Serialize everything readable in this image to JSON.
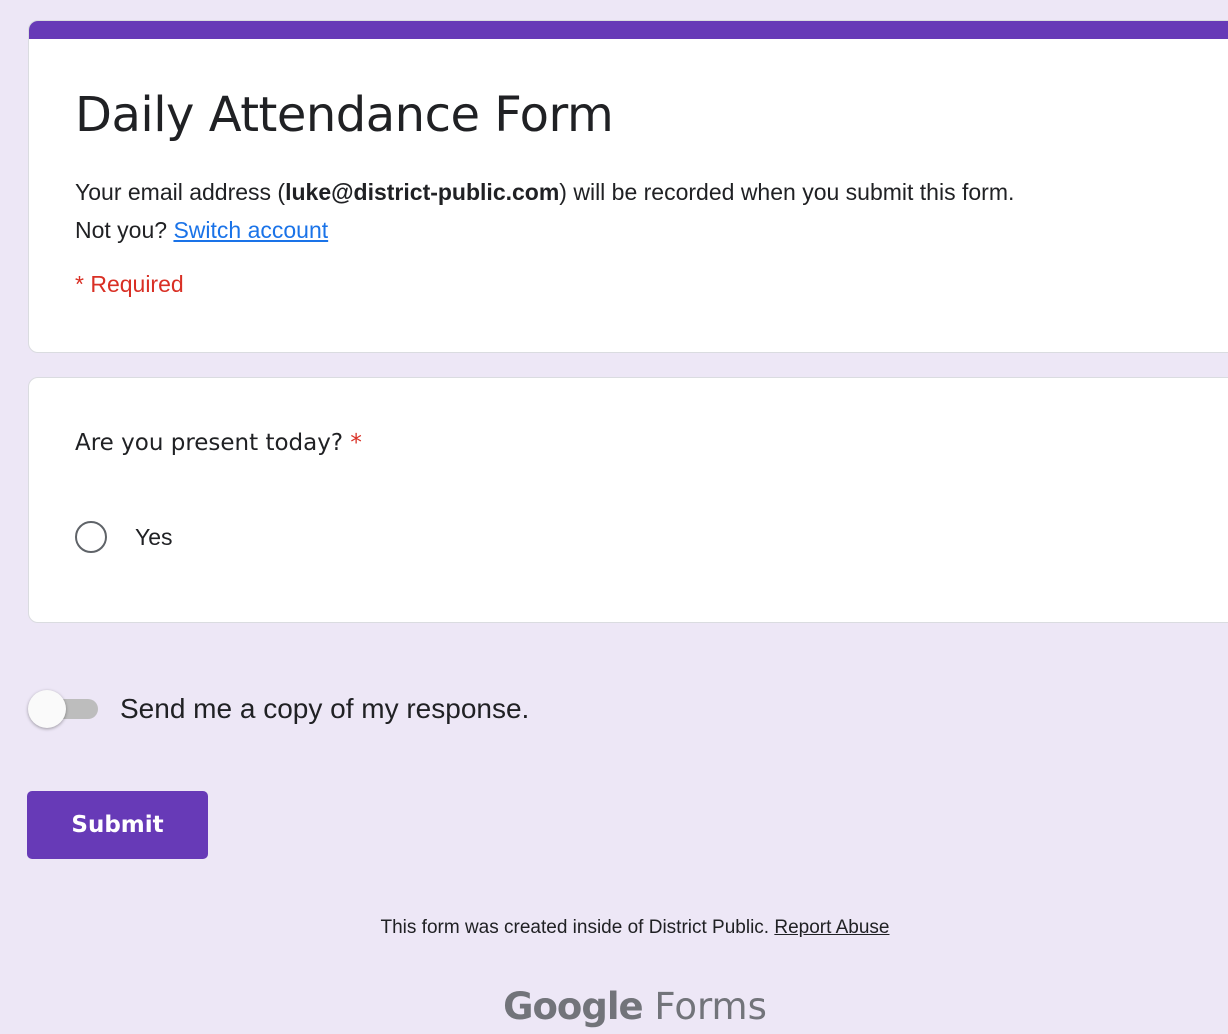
{
  "colors": {
    "accent": "#673ab7",
    "background": "#ede7f6",
    "required": "#d93025",
    "link": "#1a73e8"
  },
  "form": {
    "title": "Daily Attendance Form",
    "email_prefix": "Your email address (",
    "email": "luke@district-public.com",
    "email_suffix": ") will be recorded when you submit this form.",
    "not_you": "Not you?",
    "switch_account": "Switch account",
    "required_note": "* Required"
  },
  "question": {
    "title": "Are you present today?",
    "required_mark": "*",
    "options": [
      {
        "label": "Yes",
        "selected": false
      }
    ]
  },
  "copy_toggle": {
    "label": "Send me a copy of my response.",
    "on": false
  },
  "submit_label": "Submit",
  "footer": {
    "note": "This form was created inside of District Public.",
    "report_abuse": "Report Abuse",
    "brand_google": "Google",
    "brand_forms": "Forms"
  }
}
